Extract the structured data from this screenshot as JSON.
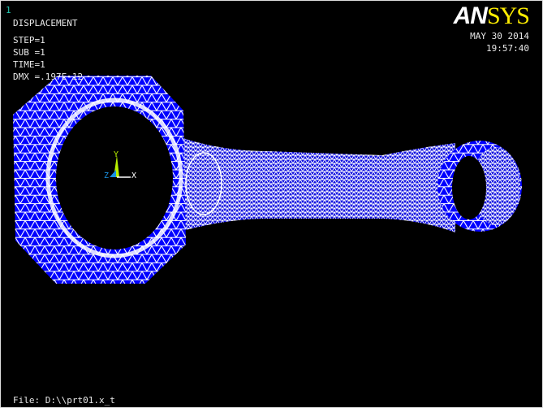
{
  "window_number": "1",
  "plot_title": "DISPLACEMENT",
  "step": "STEP=1",
  "sub": "SUB =1",
  "time": "TIME=1",
  "dmx": "DMX =.197E-12",
  "logo": {
    "part1": "AN",
    "part2": "SYS"
  },
  "date": "MAY 30 2014",
  "clock": "19:57:40",
  "file": "File: D:\\\\prt01.x_t",
  "triad": {
    "x": "X",
    "y": "Y",
    "z": "Z"
  },
  "colors": {
    "mesh_fill": "#0000ff",
    "mesh_lines": "#ffffff",
    "background": "#000000"
  }
}
